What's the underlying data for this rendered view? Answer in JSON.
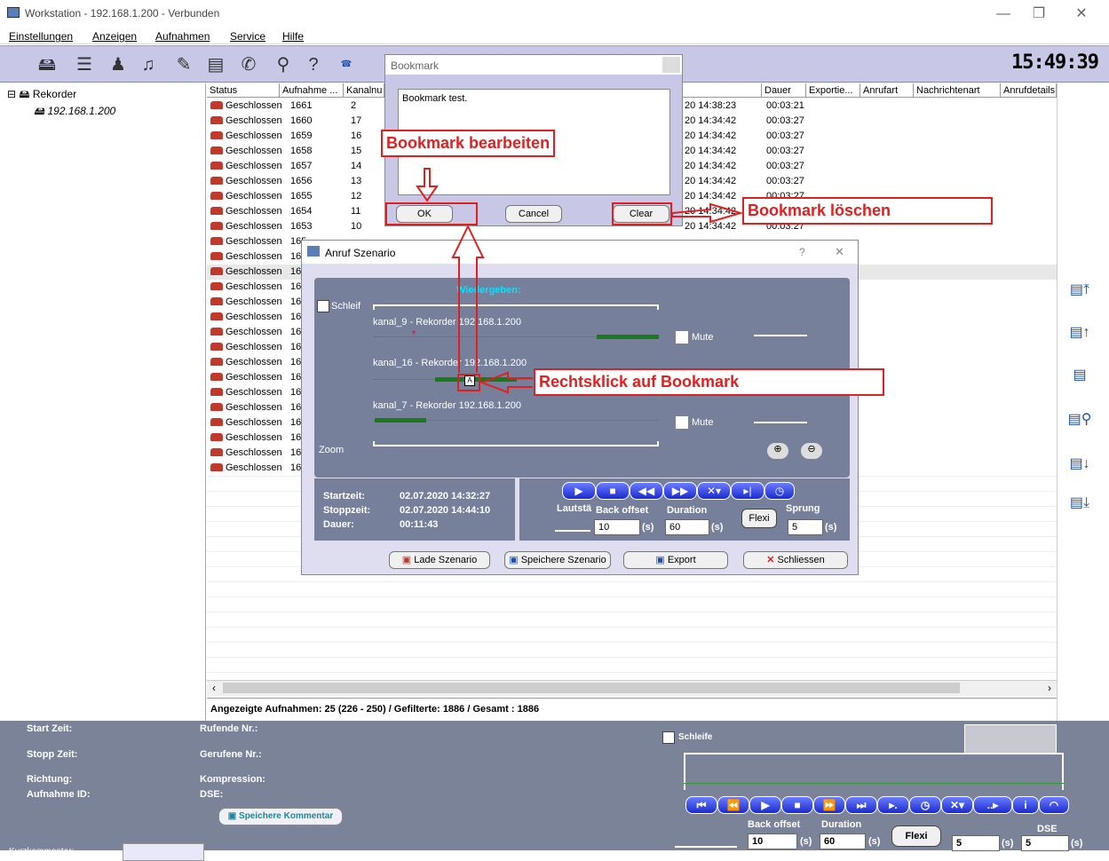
{
  "window": {
    "title": "Workstation - 192.168.1.200 - Verbunden",
    "minimize": "—",
    "maximize": "❐",
    "close": "✕"
  },
  "menu": [
    "Einstellungen",
    "Anzeigen",
    "Aufnahmen",
    "Service",
    "Hilfe"
  ],
  "clock": "15:49:39",
  "tree": {
    "root": "Rekorder",
    "child": "192.168.1.200"
  },
  "table": {
    "headers": [
      "Status",
      "Aufnahme ...",
      "Kanalnu",
      "Dauer",
      "Exportie...",
      "Anrufart",
      "Nachrichtenart",
      "Anrufdetails"
    ],
    "rows": [
      {
        "status": "Geschlossen",
        "id": "1661",
        "ch": "2",
        "end": "20 14:38:23",
        "dur": "00:03:21"
      },
      {
        "status": "Geschlossen",
        "id": "1660",
        "ch": "17",
        "end": "20 14:34:42",
        "dur": "00:03:27"
      },
      {
        "status": "Geschlossen",
        "id": "1659",
        "ch": "16",
        "end": "20 14:34:42",
        "dur": "00:03:27"
      },
      {
        "status": "Geschlossen",
        "id": "1658",
        "ch": "15",
        "end": "20 14:34:42",
        "dur": "00:03:27"
      },
      {
        "status": "Geschlossen",
        "id": "1657",
        "ch": "14",
        "end": "20 14:34:42",
        "dur": "00:03:27"
      },
      {
        "status": "Geschlossen",
        "id": "1656",
        "ch": "13",
        "end": "20 14:34:42",
        "dur": "00:03:27"
      },
      {
        "status": "Geschlossen",
        "id": "1655",
        "ch": "12",
        "end": "20 14:34:42",
        "dur": "00:03:27"
      },
      {
        "status": "Geschlossen",
        "id": "1654",
        "ch": "11",
        "end": "20 14:34:42",
        "dur": "00:03:27"
      },
      {
        "status": "Geschlossen",
        "id": "1653",
        "ch": "10",
        "end": "20 14:34:42",
        "dur": "00:03:27"
      },
      {
        "status": "Geschlossen",
        "id": "165",
        "ch": "",
        "end": "",
        "dur": ""
      },
      {
        "status": "Geschlossen",
        "id": "16",
        "ch": "",
        "end": "",
        "dur": ""
      },
      {
        "status": "Geschlossen",
        "id": "16",
        "ch": "",
        "end": "",
        "dur": ""
      },
      {
        "status": "Geschlossen",
        "id": "16",
        "ch": "",
        "end": "",
        "dur": ""
      },
      {
        "status": "Geschlossen",
        "id": "16",
        "ch": "",
        "end": "",
        "dur": ""
      },
      {
        "status": "Geschlossen",
        "id": "16",
        "ch": "",
        "end": "",
        "dur": ""
      },
      {
        "status": "Geschlossen",
        "id": "16",
        "ch": "",
        "end": "",
        "dur": ""
      },
      {
        "status": "Geschlossen",
        "id": "16",
        "ch": "",
        "end": "",
        "dur": ""
      },
      {
        "status": "Geschlossen",
        "id": "16",
        "ch": "",
        "end": "",
        "dur": ""
      },
      {
        "status": "Geschlossen",
        "id": "16",
        "ch": "",
        "end": "",
        "dur": ""
      },
      {
        "status": "Geschlossen",
        "id": "16",
        "ch": "",
        "end": "",
        "dur": ""
      },
      {
        "status": "Geschlossen",
        "id": "16",
        "ch": "",
        "end": "",
        "dur": ""
      },
      {
        "status": "Geschlossen",
        "id": "16",
        "ch": "",
        "end": "",
        "dur": ""
      },
      {
        "status": "Geschlossen",
        "id": "16",
        "ch": "",
        "end": "",
        "dur": ""
      },
      {
        "status": "Geschlossen",
        "id": "16",
        "ch": "",
        "end": "",
        "dur": ""
      },
      {
        "status": "Geschlossen",
        "id": "16",
        "ch": "",
        "end": "",
        "dur": ""
      }
    ]
  },
  "status_text": "Angezeigte Aufnahmen: 25 (226 - 250) / Gefilterte: 1886 / Gesamt : 1886",
  "bookmark": {
    "title": "Bookmark",
    "text": "Bookmark test.",
    "ok": "OK",
    "cancel": "Cancel",
    "clear": "Clear"
  },
  "anruf": {
    "title": "Anruf Szenario",
    "help": "?",
    "close": "✕",
    "loop": "Schleif",
    "playback": "Wiedergeben:",
    "zoom": "Zoom",
    "tracks": [
      "kanal_9 - Rekorder 192.168.1.200",
      "kanal_16 - Rekorder 192.168.1.200",
      "kanal_7 - Rekorder 192.168.1.200"
    ],
    "mute": "Mute",
    "start_lbl": "Startzeit:",
    "start": "02.07.2020 14:32:27",
    "stop_lbl": "Stoppzeit:",
    "stop": "02.07.2020 14:44:10",
    "dur_lbl": "Dauer:",
    "dur": "00:11:43",
    "lautst": "Lautstä",
    "backoffset": "Back offset",
    "duration": "Duration",
    "flexi": "Flexi",
    "sprung": "Sprung",
    "bo_val": "10",
    "dur_val": "60",
    "sprung_val": "5",
    "unit": "(s)",
    "load": "Lade Szenario",
    "save": "Speichere Szenario",
    "export": "Export",
    "closebtn": "Schliessen"
  },
  "annotations": {
    "edit": "Bookmark bearbeiten",
    "delete": "Bookmark löschen",
    "rightclick": "Rechtsklick auf Bookmark"
  },
  "bottom": {
    "start": "Start Zeit:",
    "stop": "Stopp Zeit:",
    "dir": "Richtung:",
    "recid": "Aufnahme ID:",
    "short": "Kurzkommentar:",
    "caller": "Rufende Nr.:",
    "called": "Gerufene Nr.:",
    "comp": "Kompression:",
    "dse": "DSE:",
    "savecomment": "Speichere Kommentar",
    "loop": "Schleife",
    "backoffset": "Back offset",
    "duration": "Duration",
    "flexi": "Flexi",
    "dse2": "DSE",
    "bo_val": "10",
    "dur_val": "60",
    "v1": "5",
    "v2": "5",
    "unit": "(s)"
  },
  "colors": {
    "accent": "#1a2bcf",
    "annotation": "#e02020",
    "panel": "#7b8399"
  }
}
